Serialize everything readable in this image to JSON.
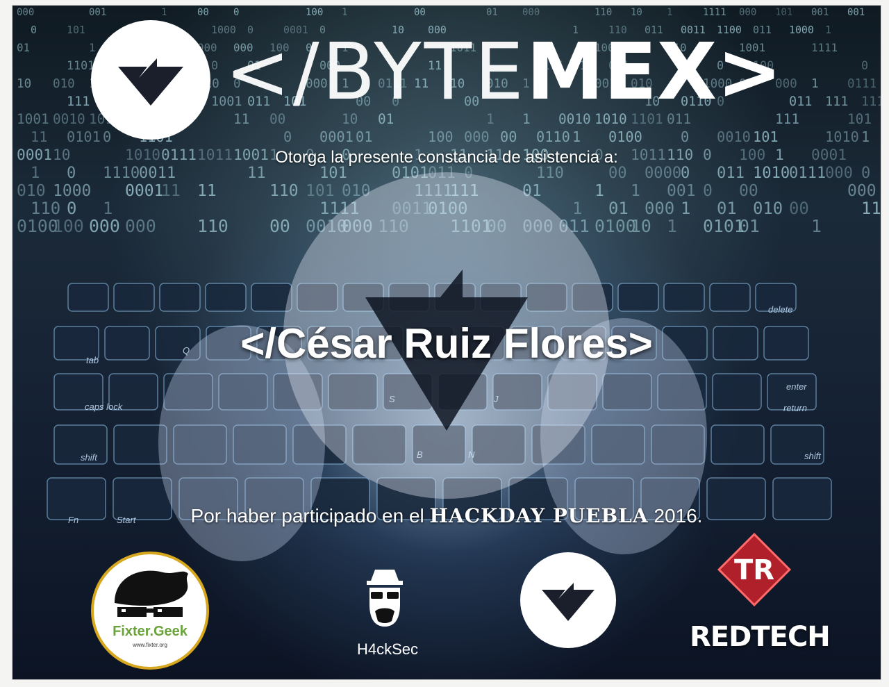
{
  "brand": {
    "prefix": "</",
    "thin": "BYTE",
    "bold": "MEX",
    "suffix": ">"
  },
  "certificate": {
    "intro": "Otorga la presente constancia de asistencia a:",
    "recipient": "</César Ruiz Flores>",
    "reason_prefix": "Por haber participado en el ",
    "event": "HACKDAY PUEBLA",
    "year": " 2016."
  },
  "sponsors": {
    "fixter_name": "Fixter.Geek",
    "fixter_url": "www.fixter.org",
    "hacksec_name": "H4ckSec",
    "redtech_name": "REDTECH"
  },
  "keyboard_labels": [
    "tab",
    "caps lock",
    "shift",
    "Fn",
    "Start",
    "delete",
    "enter",
    "return",
    "shift",
    "Q",
    "S",
    "J",
    "N",
    "B"
  ],
  "colors": {
    "background_dark": "#0f1a22",
    "accent_cyan": "#8fd0dc",
    "redtech_red": "#b0202a",
    "fixter_gold": "#d7a71e",
    "fixter_green": "#6aa33a"
  },
  "icons": {
    "main_logo": "bytemex-arrow-logo",
    "hacksec": "hacker-face-icon",
    "redtech": "redtech-diamond-emblem"
  }
}
